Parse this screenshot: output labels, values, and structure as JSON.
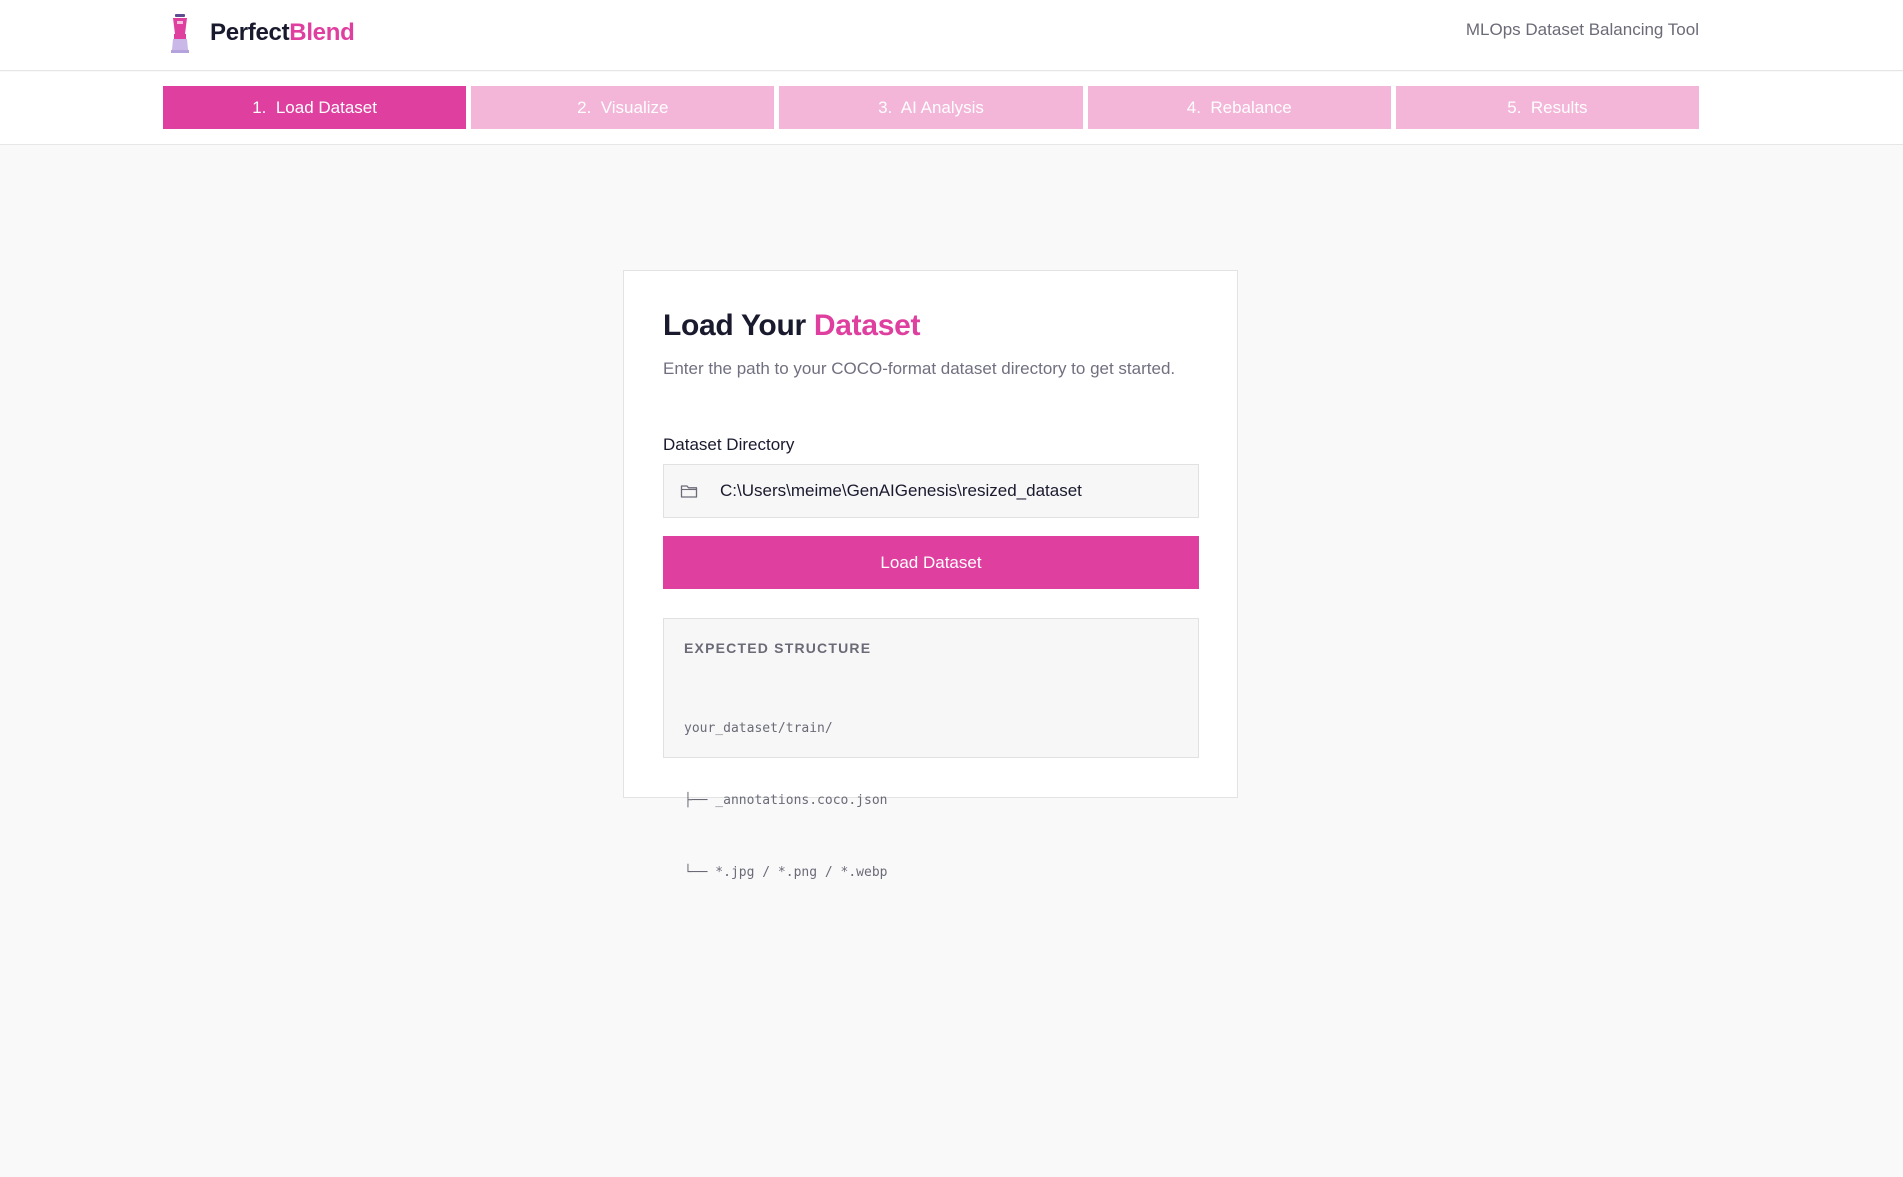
{
  "header": {
    "brand_part1": "Perfect",
    "brand_part2": "Blend",
    "logo_icon": "blender-icon",
    "tagline": "MLOps Dataset Balancing Tool"
  },
  "steps": [
    {
      "label": "1.  Load Dataset",
      "active": true
    },
    {
      "label": "2.  Visualize",
      "active": false
    },
    {
      "label": "3.  AI Analysis",
      "active": false
    },
    {
      "label": "4.  Rebalance",
      "active": false
    },
    {
      "label": "5.  Results",
      "active": false
    }
  ],
  "card": {
    "title_part1": "Load Your ",
    "title_part2": "Dataset",
    "description": "Enter the path to your COCO-format dataset directory to get started.",
    "field_label": "Dataset Directory",
    "field_icon": "folder-icon",
    "field_value": "C:\\Users\\meime\\GenAIGenesis\\resized_dataset",
    "button_label": "Load Dataset",
    "structure_title": "EXPECTED STRUCTURE",
    "structure_lines": [
      "your_dataset/train/",
      "├── _annotations.coco.json",
      "└── *.jpg / *.png / *.webp"
    ]
  },
  "colors": {
    "accent": "#df3f9f",
    "accent_light": "#f3b5d8",
    "text_dark": "#1a1a2e",
    "text_muted": "#6b6b78",
    "background": "#f9f9f9"
  }
}
